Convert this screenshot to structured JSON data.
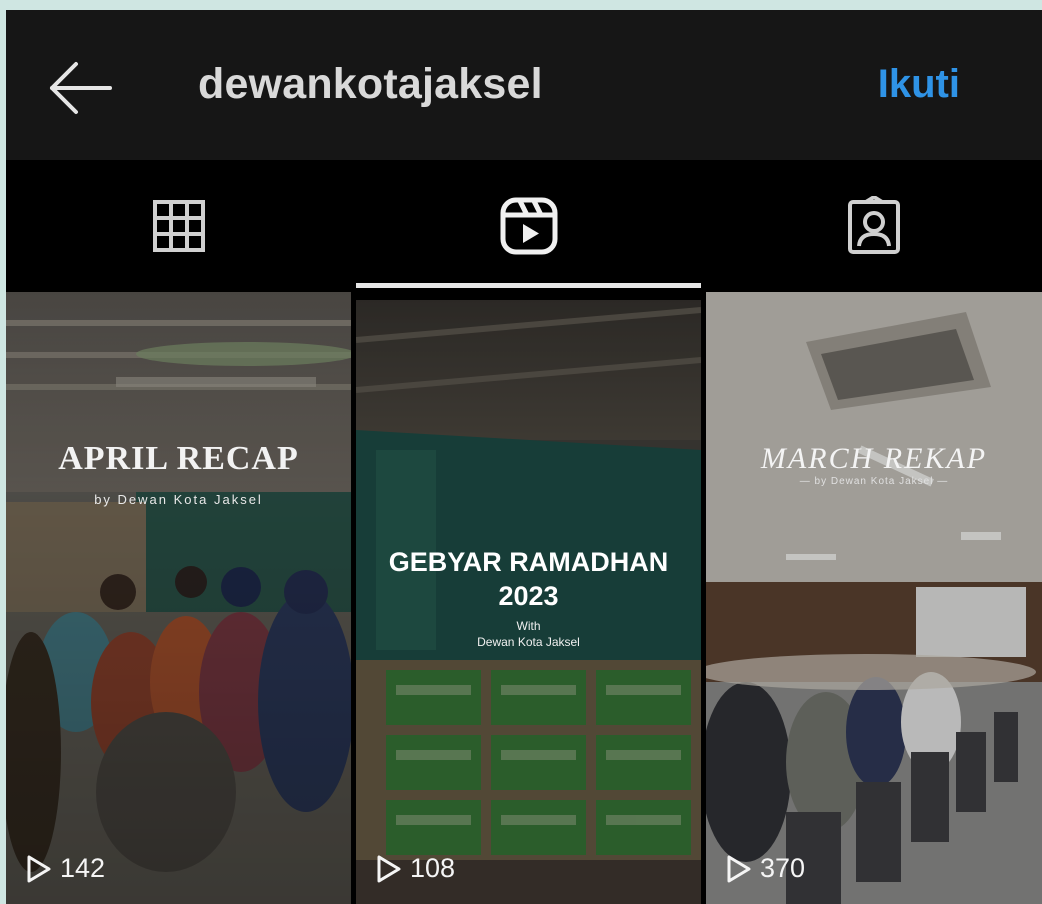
{
  "header": {
    "username": "dewankotajaksel",
    "follow_label": "Ikuti",
    "back_icon": "arrow-left-icon"
  },
  "tabs": [
    {
      "icon": "grid-icon",
      "active": false
    },
    {
      "icon": "reels-icon",
      "active": true
    },
    {
      "icon": "tagged-icon",
      "active": false
    }
  ],
  "reels": [
    {
      "title": "APRIL RECAP",
      "subtitle": "by Dewan Kota Jaksel",
      "views": "142"
    },
    {
      "title_line1": "GEBYAR RAMADHAN",
      "title_line2": "2023",
      "subtitle_line1": "With",
      "subtitle_line2": "Dewan Kota Jaksel",
      "views": "108"
    },
    {
      "title": "MARCH REKAP",
      "subtitle": "— by Dewan Kota Jaksel —",
      "views": "370"
    }
  ],
  "colors": {
    "header_bg": "#161616",
    "tab_bg": "#000000",
    "accent": "#2f93e6",
    "username": "#d9d9d9"
  }
}
